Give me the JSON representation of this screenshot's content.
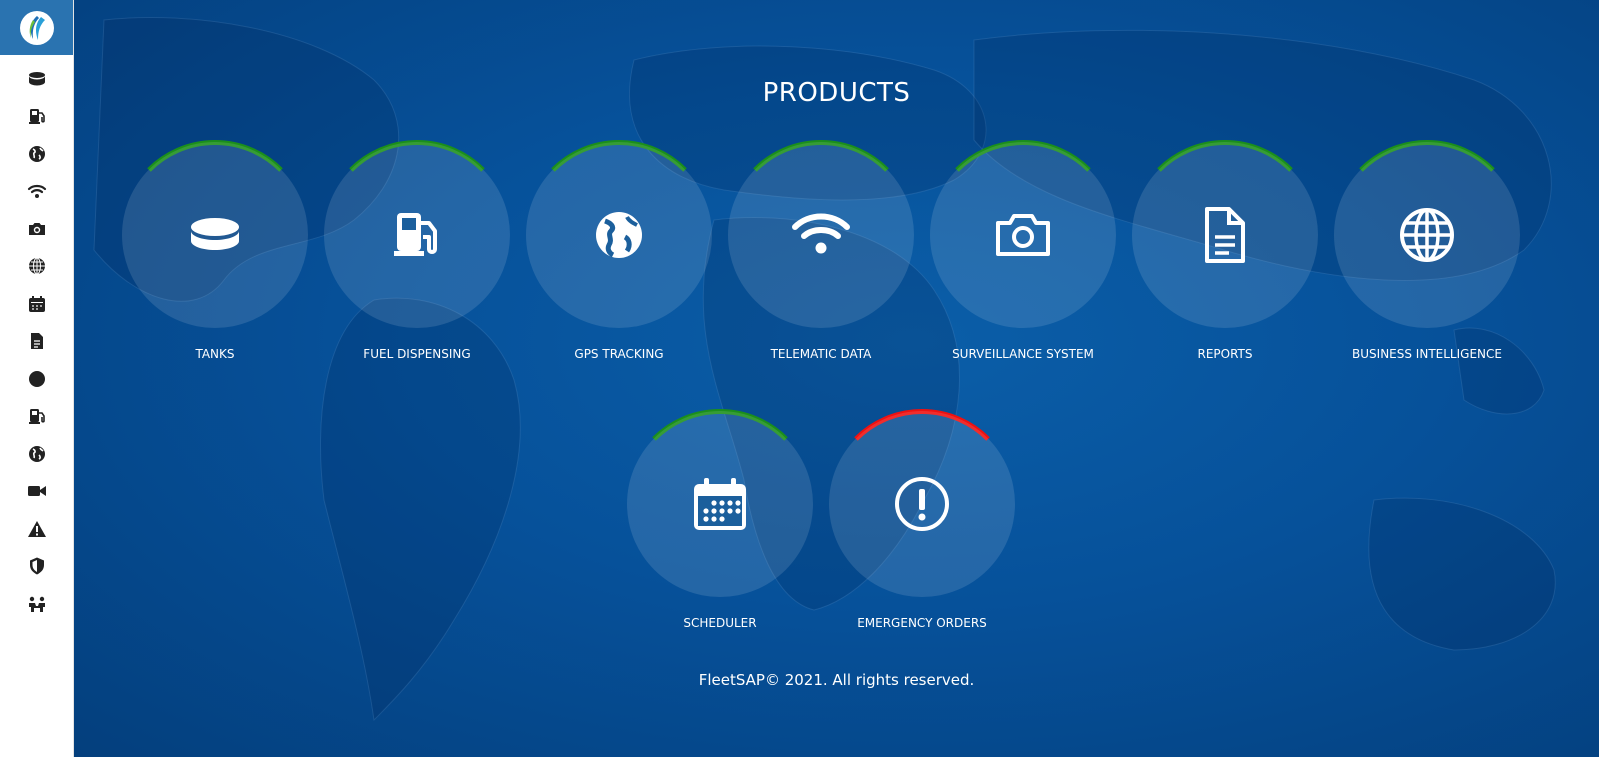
{
  "app": {
    "logo_icon": "fleetsap-logo-icon"
  },
  "sidebar": {
    "items": [
      {
        "icon": "tank-icon"
      },
      {
        "icon": "gas-pump-icon"
      },
      {
        "icon": "globe-americas-icon"
      },
      {
        "icon": "wifi-icon"
      },
      {
        "icon": "camera-icon"
      },
      {
        "icon": "globe-grid-icon"
      },
      {
        "icon": "calendar-icon"
      },
      {
        "icon": "document-icon"
      },
      {
        "icon": "circle-icon"
      },
      {
        "icon": "gas-pump-icon"
      },
      {
        "icon": "globe-americas-icon"
      },
      {
        "icon": "video-camera-icon"
      },
      {
        "icon": "warning-icon"
      },
      {
        "icon": "shield-icon"
      },
      {
        "icon": "people-icon"
      }
    ]
  },
  "main": {
    "title": "PRODUCTS",
    "products": [
      {
        "label": "TANKS",
        "icon": "tank-icon",
        "status_color": "#1b8f1b"
      },
      {
        "label": "FUEL DISPENSING",
        "icon": "gas-pump-icon",
        "status_color": "#1b8f1b"
      },
      {
        "label": "GPS TRACKING",
        "icon": "globe-americas-icon",
        "status_color": "#1b8f1b"
      },
      {
        "label": "TELEMATIC DATA",
        "icon": "wifi-icon",
        "status_color": "#1b8f1b"
      },
      {
        "label": "SURVEILLANCE SYSTEM",
        "icon": "camera-icon",
        "status_color": "#1b8f1b"
      },
      {
        "label": "REPORTS",
        "icon": "document-icon",
        "status_color": "#1b8f1b"
      },
      {
        "label": "BUSINESS INTELLIGENCE",
        "icon": "globe-grid-icon",
        "status_color": "#1b8f1b"
      },
      {
        "label": "SCHEDULER",
        "icon": "calendar-icon",
        "status_color": "#1b8f1b"
      },
      {
        "label": "EMERGENCY ORDERS",
        "icon": "alert-circle-icon",
        "status_color": "#ee1111"
      }
    ],
    "footer": "FleetSAP© 2021. All rights reserved."
  }
}
